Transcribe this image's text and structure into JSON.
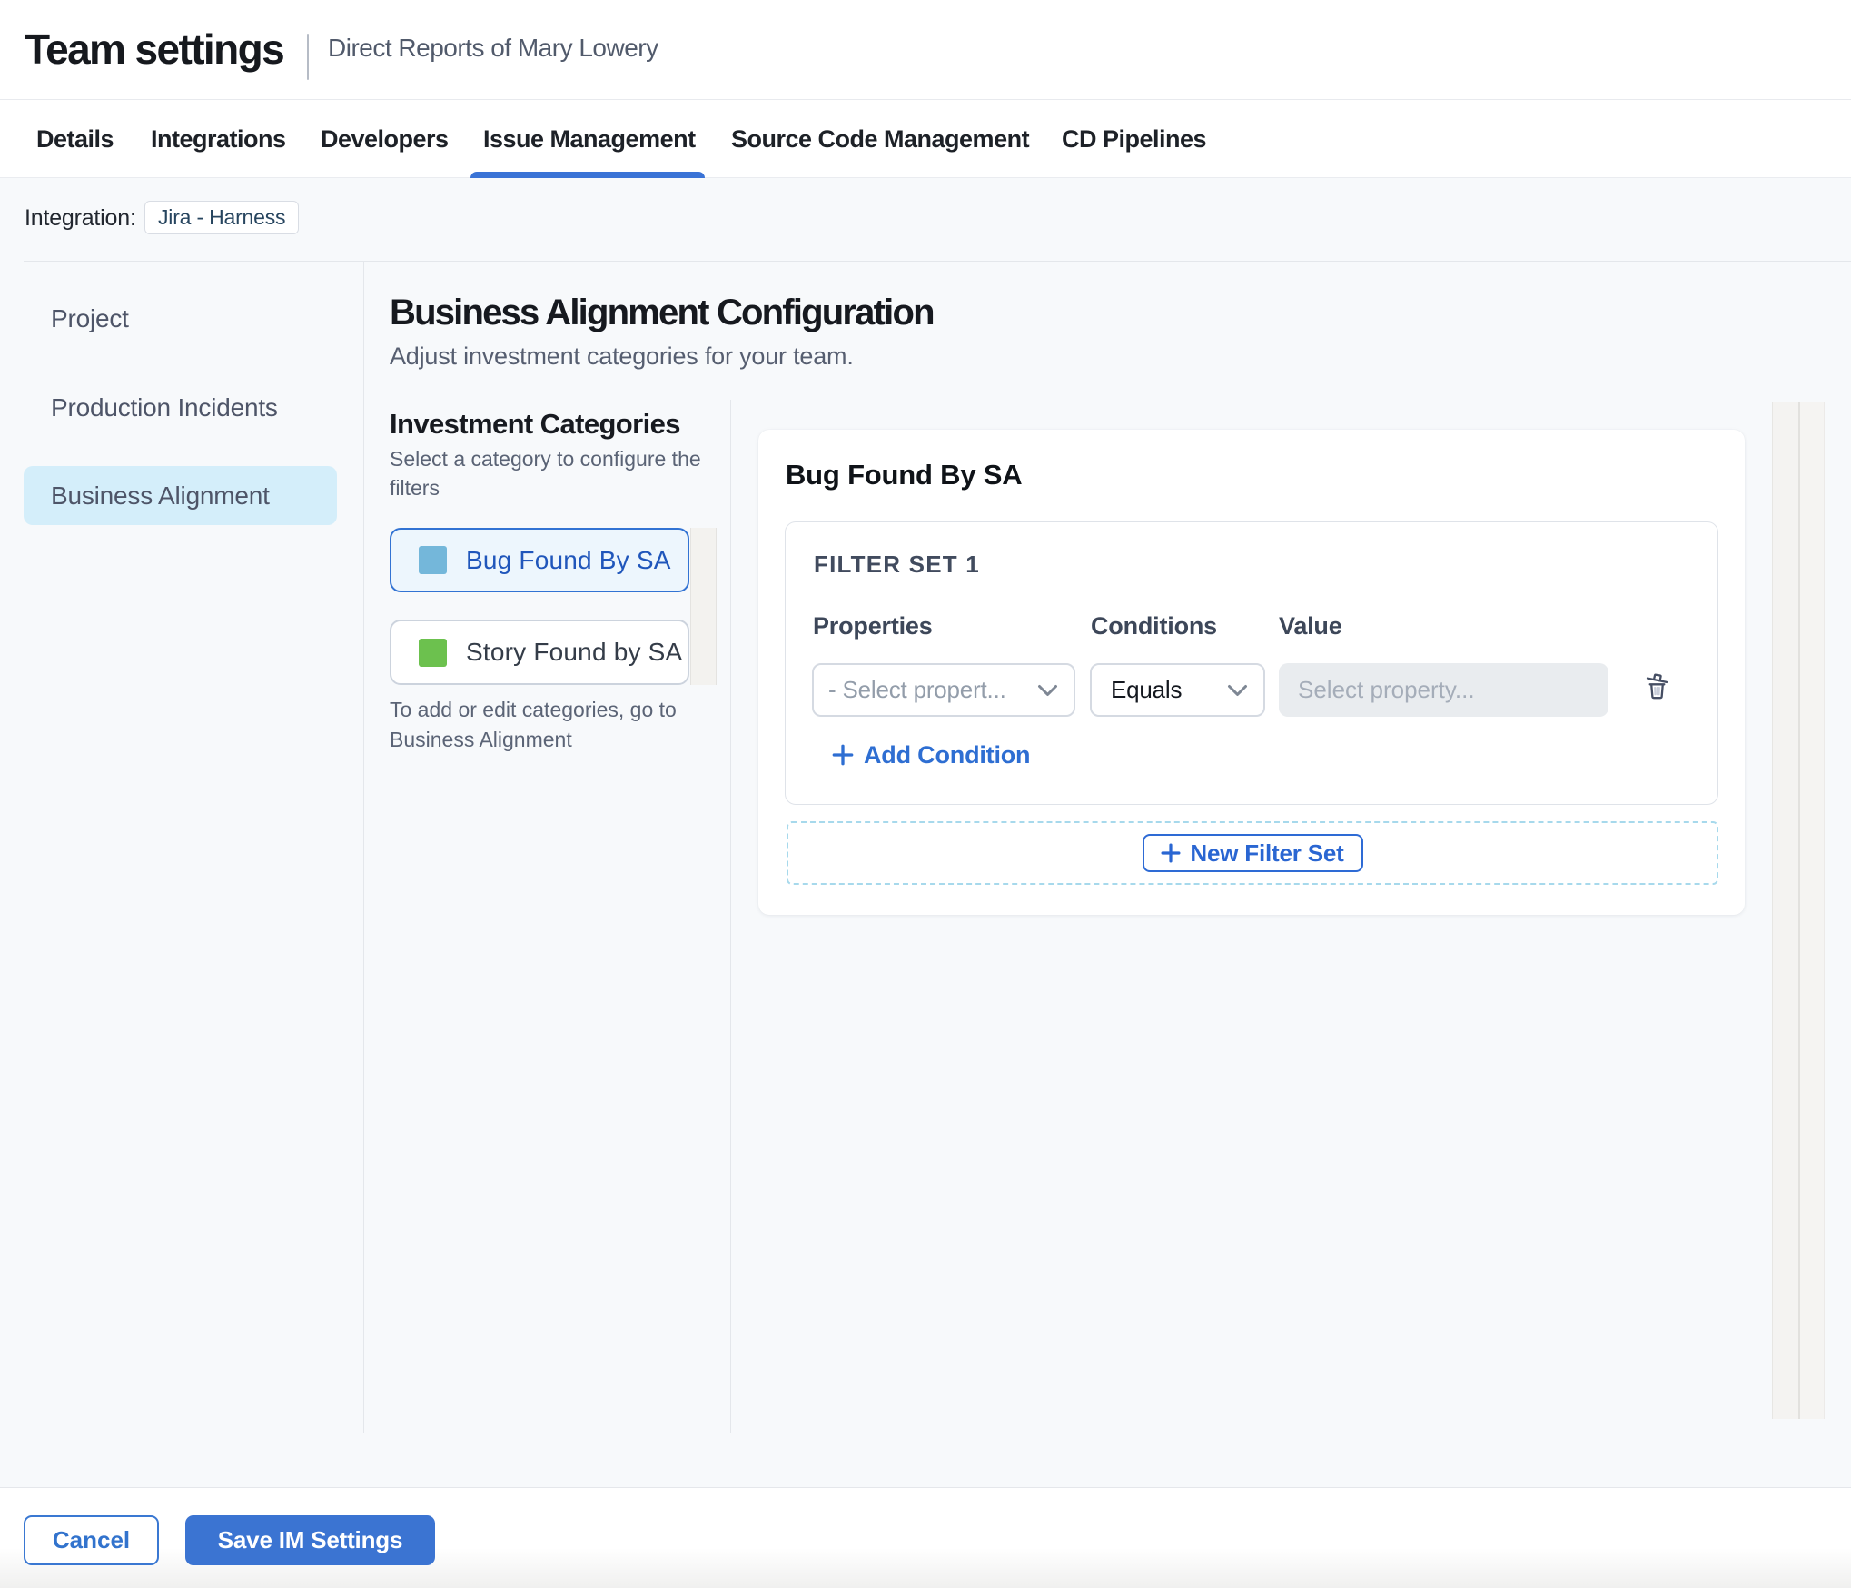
{
  "header": {
    "title": "Team settings",
    "subtitle": "Direct Reports of Mary Lowery"
  },
  "tabs": [
    {
      "label": "Details",
      "active": false
    },
    {
      "label": "Integrations",
      "active": false
    },
    {
      "label": "Developers",
      "active": false
    },
    {
      "label": "Issue Management",
      "active": true
    },
    {
      "label": "Source Code Management",
      "active": false
    },
    {
      "label": "CD Pipelines",
      "active": false
    }
  ],
  "integration": {
    "label": "Integration:",
    "chip": "Jira - Harness"
  },
  "sidebar": {
    "items": [
      {
        "label": "Project",
        "selected": false
      },
      {
        "label": "Production Incidents",
        "selected": false
      },
      {
        "label": "Business Alignment",
        "selected": true
      }
    ]
  },
  "main": {
    "title": "Business Alignment Configuration",
    "subtitle": "Adjust investment categories for your team.",
    "investment_categories": {
      "heading": "Investment Categories",
      "hint": "Select a category to configure the filters",
      "items": [
        {
          "label": "Bug Found By SA",
          "color": "#74b7da",
          "selected": true
        },
        {
          "label": "Story Found by SA",
          "color": "#6cc14e",
          "selected": false
        }
      ],
      "footnote": "To add or edit categories, go to Business Alignment"
    },
    "filter_panel": {
      "title": "Bug Found By SA",
      "filter_set_label": "FILTER SET 1",
      "columns": {
        "properties": "Properties",
        "conditions": "Conditions",
        "value": "Value"
      },
      "property_placeholder": "- Select propert...",
      "condition_value": "Equals",
      "value_placeholder": "Select property...",
      "add_condition_label": "Add Condition",
      "new_filter_set_label": "New Filter Set"
    }
  },
  "footer": {
    "cancel_label": "Cancel",
    "save_label": "Save IM Settings"
  },
  "colors": {
    "accent_blue": "#3a73d6",
    "selected_category_border": "#3273d3",
    "selected_category_bg": "#edf6fd",
    "selected_category_text": "#2056bb",
    "sidebar_selected_bg": "#d4eefa",
    "bug_swatch": "#74b7da",
    "story_swatch": "#6cc14e",
    "content_bg": "#f7f9fb"
  }
}
